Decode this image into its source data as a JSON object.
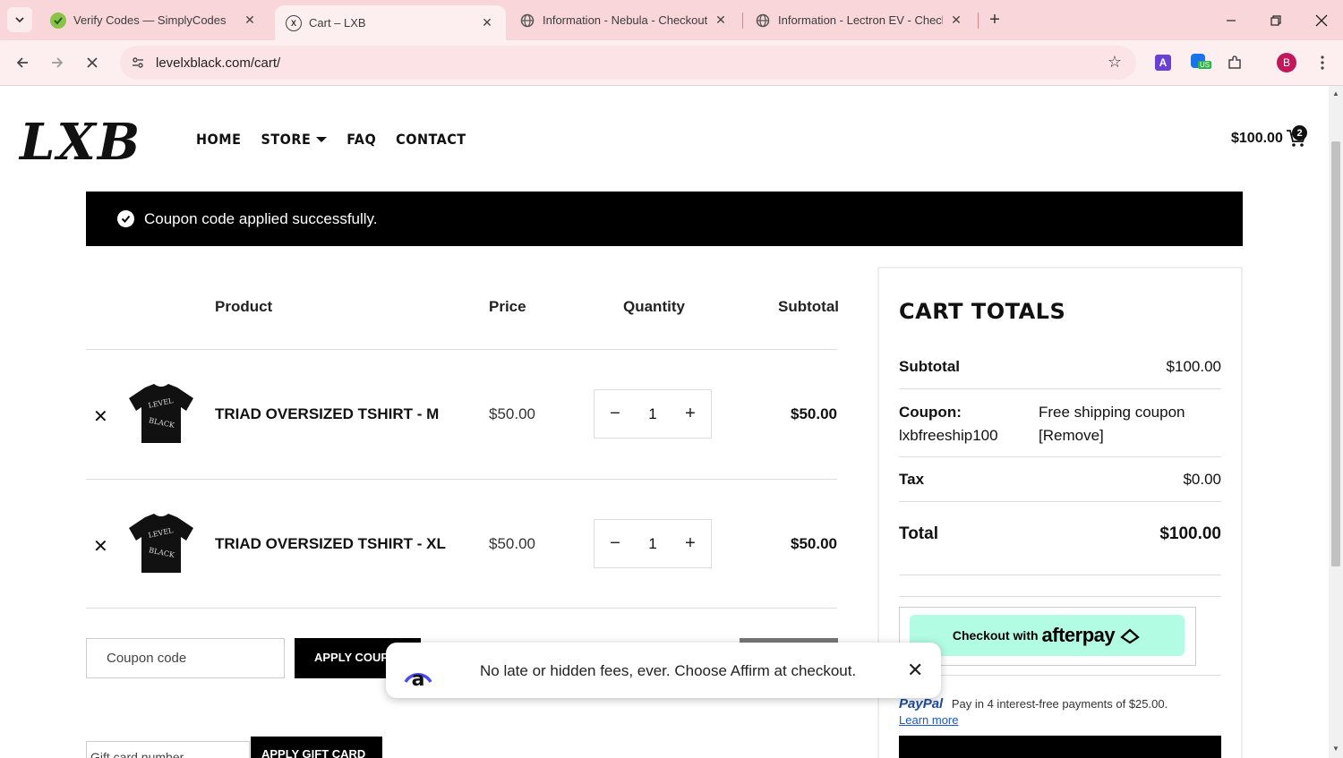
{
  "browser": {
    "tabs": [
      {
        "title": "Verify Codes — SimplyCodes"
      },
      {
        "title": "Cart – LXB"
      },
      {
        "title": "Information - Nebula - Checkout"
      },
      {
        "title": "Information - Lectron EV - Checkout"
      }
    ],
    "url": "levelxblack.com/cart/",
    "profile_initial": "B",
    "ext_badge": "US"
  },
  "site": {
    "logo": "LXB",
    "nav": [
      "HOME",
      "STORE",
      "FAQ",
      "CONTACT"
    ],
    "cart_total": "$100.00",
    "cart_count": "2"
  },
  "notice": "Coupon code applied successfully.",
  "cart": {
    "headers": {
      "product": "Product",
      "price": "Price",
      "quantity": "Quantity",
      "subtotal": "Subtotal"
    },
    "items": [
      {
        "name": "TRIAD OVERSIZED TSHIRT - M",
        "price": "$50.00",
        "qty": "1",
        "subtotal": "$50.00"
      },
      {
        "name": "TRIAD OVERSIZED TSHIRT - XL",
        "price": "$50.00",
        "qty": "1",
        "subtotal": "$50.00"
      }
    ],
    "coupon_placeholder": "Coupon code",
    "apply_coupon": "APPLY COUPON",
    "gift_placeholder": "Gift card number",
    "apply_gift": "APPLY GIFT CARD"
  },
  "totals": {
    "title": "CART TOTALS",
    "subtotal_label": "Subtotal",
    "subtotal_value": "$100.00",
    "coupon_label_1": "Coupon:",
    "coupon_label_2": "lxbfreeship100",
    "coupon_value_1": "Free shipping coupon",
    "coupon_value_2": "[Remove]",
    "tax_label": "Tax",
    "tax_value": "$0.00",
    "total_label": "Total",
    "total_value": "$100.00",
    "afterpay_prefix": "Checkout with",
    "afterpay_brand": "afterpay",
    "paypal_brand": "PayPal",
    "paypal_text": "Pay in 4 interest-free payments of $25.00.",
    "paypal_learn": "Learn more"
  },
  "affirm": {
    "message": "No late or hidden fees, ever. Choose Affirm at checkout."
  }
}
